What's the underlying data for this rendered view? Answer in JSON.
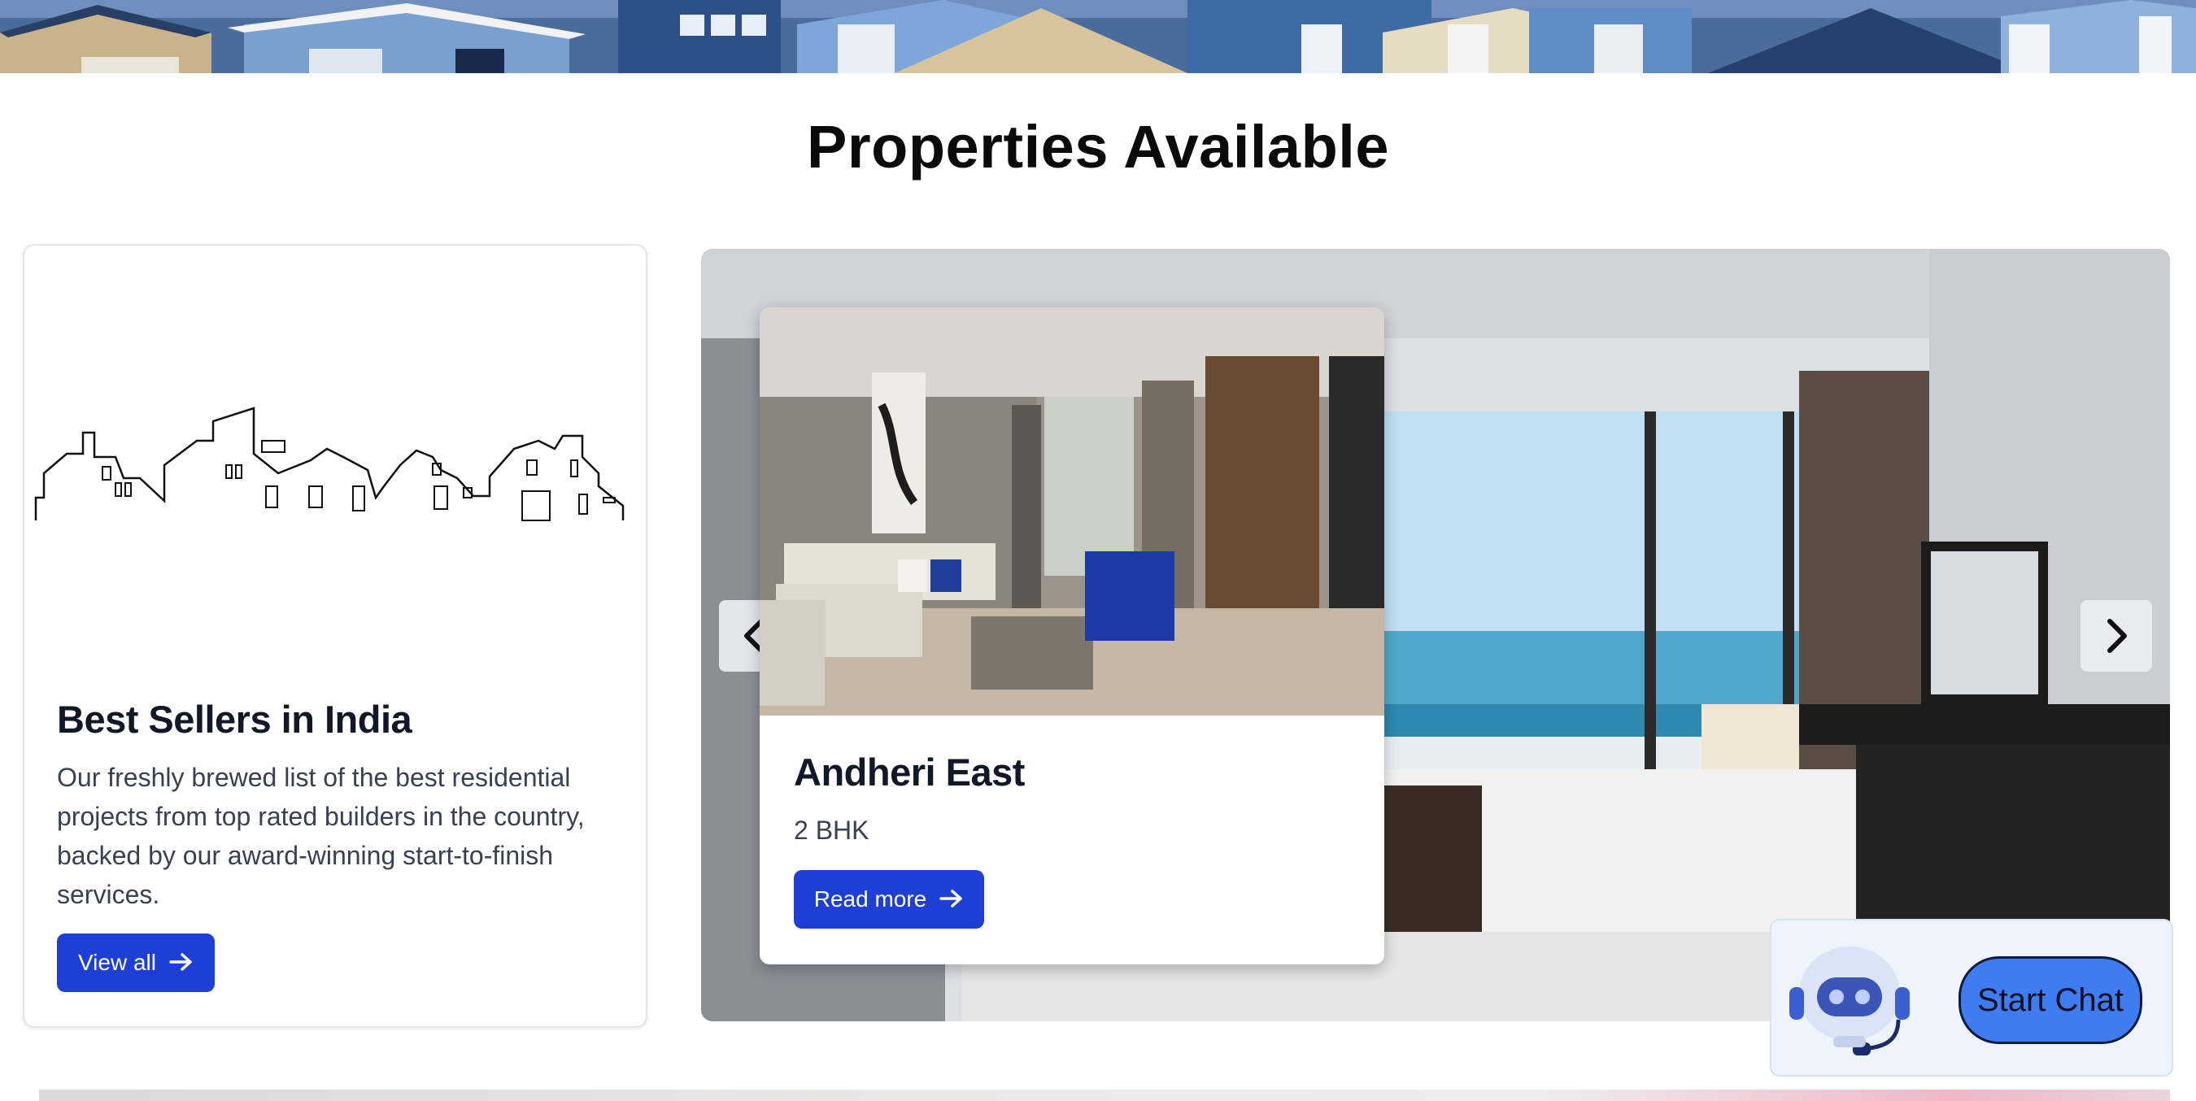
{
  "page": {
    "title": "Properties Available"
  },
  "best_sellers": {
    "title": "Best Sellers in India",
    "description": "Our freshly brewed list of the best residential projects from top rated builders in the country, backed by our award-winning start-to-finish services.",
    "button_label": "View all",
    "button_icon": "arrow-right-icon"
  },
  "carousel": {
    "prev_icon": "chevron-left-icon",
    "next_icon": "chevron-right-icon",
    "property": {
      "title": "Andheri East",
      "subtitle": "2 BHK",
      "button_label": "Read more",
      "button_icon": "arrow-right-icon"
    }
  },
  "chat": {
    "button_label": "Start Chat",
    "avatar_icon": "robot-icon"
  },
  "colors": {
    "primary": "#1d3fd6",
    "chat_button": "#3f7cf2",
    "chat_bg": "#eef4fc"
  }
}
